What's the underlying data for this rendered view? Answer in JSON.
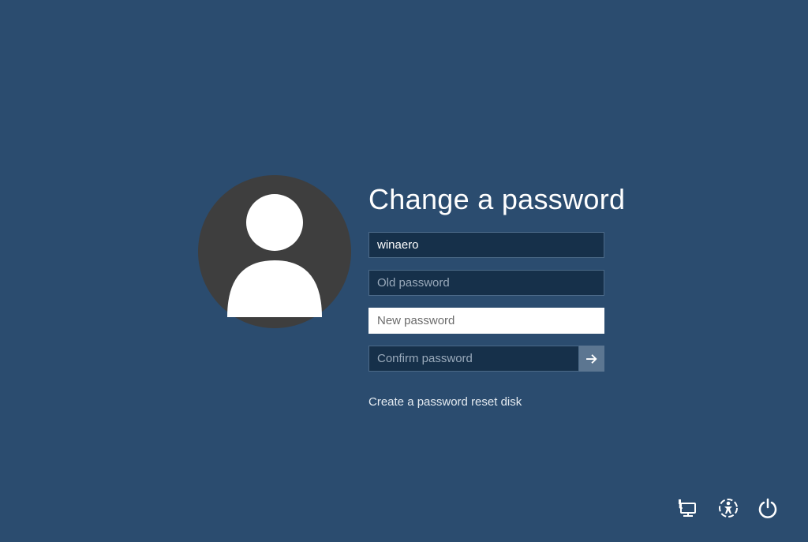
{
  "title": "Change a password",
  "username": {
    "value": "winaero"
  },
  "oldPassword": {
    "placeholder": "Old password",
    "value": ""
  },
  "newPassword": {
    "placeholder": "New password",
    "value": ""
  },
  "confirmPassword": {
    "placeholder": "Confirm password",
    "value": ""
  },
  "resetLink": "Create a password reset disk"
}
